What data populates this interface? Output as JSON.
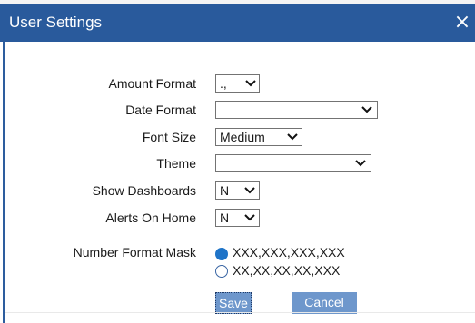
{
  "dialog": {
    "title": "User Settings",
    "close_symbol": "×"
  },
  "fields": {
    "amount_format": {
      "label": "Amount Format",
      "value": ".,"
    },
    "date_format": {
      "label": "Date Format",
      "value": ""
    },
    "font_size": {
      "label": "Font Size",
      "value": "Medium"
    },
    "theme": {
      "label": "Theme",
      "value": ""
    },
    "show_dashboards": {
      "label": "Show Dashboards",
      "value": "N"
    },
    "alerts_on_home": {
      "label": "Alerts On Home",
      "value": "N"
    },
    "number_format_mask": {
      "label": "Number Format Mask",
      "options": [
        {
          "label": "XXX,XXX,XXX,XXX",
          "selected": true
        },
        {
          "label": "XX,XX,XX,XX,XXX",
          "selected": false
        }
      ]
    }
  },
  "buttons": {
    "save": "Save",
    "cancel": "Cancel"
  },
  "colors": {
    "titlebar": "#295a9c",
    "radio_selected": "#1f74c8",
    "button": "#6e97cc"
  }
}
